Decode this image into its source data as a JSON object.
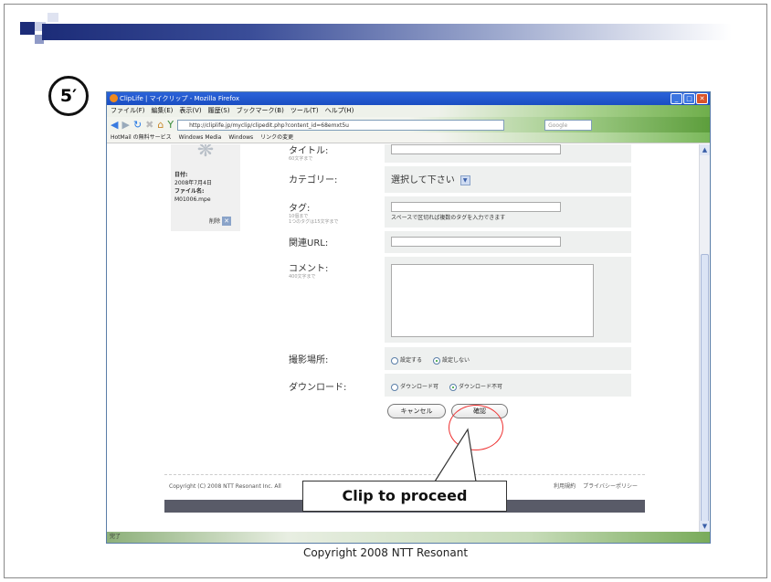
{
  "slide": {
    "step_label": "5′",
    "callout": "Clip to proceed",
    "copyright": "Copyright 2008 NTT Resonant"
  },
  "browser": {
    "title": "ClipLife | マイクリップ - Mozilla Firefox",
    "menu": [
      "ファイル(F)",
      "編集(E)",
      "表示(V)",
      "履歴(S)",
      "ブックマーク(B)",
      "ツール(T)",
      "ヘルプ(H)"
    ],
    "url": "http://cliplife.jp/myclip/clipedit.php?content_id=68emxt5u",
    "search_placeholder": "Google",
    "bookmarks": [
      "HotMail の無料サービス",
      "Windows Media",
      "Windows",
      "リンクの変更"
    ],
    "status": "完了"
  },
  "page": {
    "meta": {
      "date_label": "日付:",
      "date_value": "2008年7月4日",
      "file_label": "ファイル名:",
      "file_value": "M01006.mpe",
      "delete_label": "削除"
    },
    "form": {
      "title_label": "タイトル:",
      "title_sub": "60文字まで",
      "category_label": "カテゴリー:",
      "category_value": "選択して下さい",
      "tags_label": "タグ:",
      "tags_sub1": "10個まで",
      "tags_sub2": "1つのタグは15文字まで",
      "tags_hint": "スペースで区切れば複数のタグを入力できます",
      "url_label": "関連URL:",
      "comment_label": "コメント:",
      "comment_sub": "400文字まで",
      "location_label": "撮影場所:",
      "location_opt1": "設定する",
      "location_opt2": "設定しない",
      "download_label": "ダウンロード:",
      "download_opt1": "ダウンロード可",
      "download_opt2": "ダウンロード不可",
      "cancel_button": "キャンセル",
      "confirm_button": "確認"
    },
    "footer": {
      "copyright": "Copyright (C) 2008 NTT Resonant Inc. All",
      "links": [
        "利用規約",
        "プライバシーポリシー"
      ]
    }
  }
}
